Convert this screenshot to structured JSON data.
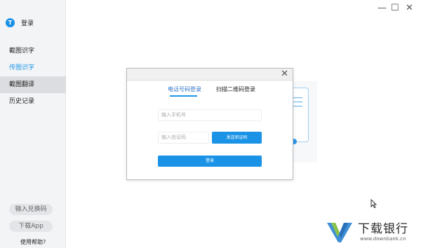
{
  "sidebar": {
    "logo_letter": "T",
    "login_label": "登录",
    "items": [
      {
        "label": "截图识字"
      },
      {
        "label": "传图识字"
      },
      {
        "label": "截图翻译"
      },
      {
        "label": "历史记录"
      }
    ],
    "redeem_label": "输入兑换码",
    "download_label": "下载App",
    "help_label": "使用帮助?"
  },
  "window": {
    "minimize": "—",
    "maximize": "☐",
    "close": "✕"
  },
  "dialog": {
    "close": "✕",
    "tabs": [
      {
        "label": "电话号码登录"
      },
      {
        "label": "扫描二维码登录"
      }
    ],
    "phone_placeholder": "输入手机号",
    "code_placeholder": "输入验证码",
    "send_code_label": "发送验证码",
    "login_label": "登录"
  },
  "watermark": {
    "title": "下载银行",
    "url": "www.downbank.cn"
  },
  "colors": {
    "accent": "#1a93e6",
    "active_nav": "#1f97e8",
    "sidebar_bg": "#f3f4f6"
  }
}
